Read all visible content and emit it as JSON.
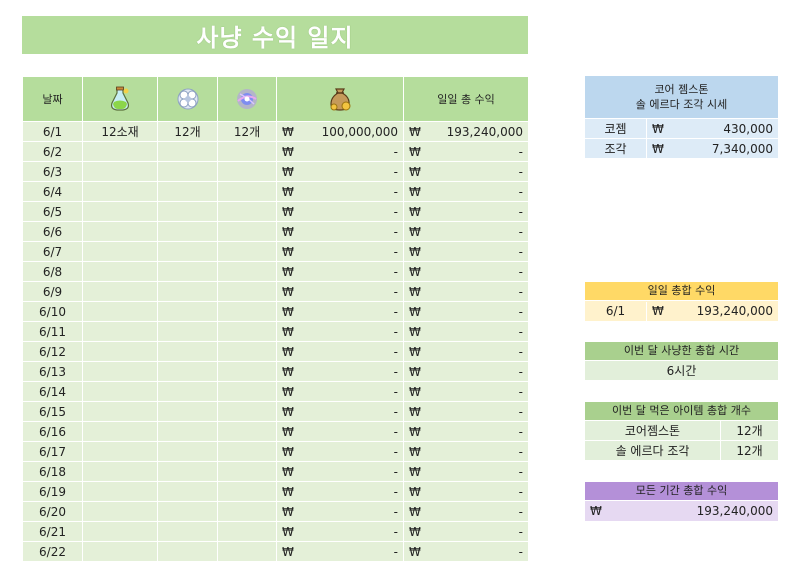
{
  "title": "사냥 수익 일지",
  "table": {
    "headers": {
      "date": "날짜",
      "total": "일일 총 수익"
    },
    "header_icons": [
      "potion-icon",
      "core-gemstone-icon",
      "sol-erda-fragment-icon",
      "meso-bag-icon"
    ],
    "currency": "₩",
    "rows": [
      {
        "date": "6/1",
        "col1": "12소재",
        "col2": "12개",
        "col3": "12개",
        "meso": "100,000,000",
        "total": "193,240,000"
      },
      {
        "date": "6/2",
        "col1": "",
        "col2": "",
        "col3": "",
        "meso": "-",
        "total": "-"
      },
      {
        "date": "6/3",
        "col1": "",
        "col2": "",
        "col3": "",
        "meso": "-",
        "total": "-"
      },
      {
        "date": "6/4",
        "col1": "",
        "col2": "",
        "col3": "",
        "meso": "-",
        "total": "-"
      },
      {
        "date": "6/5",
        "col1": "",
        "col2": "",
        "col3": "",
        "meso": "-",
        "total": "-"
      },
      {
        "date": "6/6",
        "col1": "",
        "col2": "",
        "col3": "",
        "meso": "-",
        "total": "-"
      },
      {
        "date": "6/7",
        "col1": "",
        "col2": "",
        "col3": "",
        "meso": "-",
        "total": "-"
      },
      {
        "date": "6/8",
        "col1": "",
        "col2": "",
        "col3": "",
        "meso": "-",
        "total": "-"
      },
      {
        "date": "6/9",
        "col1": "",
        "col2": "",
        "col3": "",
        "meso": "-",
        "total": "-"
      },
      {
        "date": "6/10",
        "col1": "",
        "col2": "",
        "col3": "",
        "meso": "-",
        "total": "-"
      },
      {
        "date": "6/11",
        "col1": "",
        "col2": "",
        "col3": "",
        "meso": "-",
        "total": "-"
      },
      {
        "date": "6/12",
        "col1": "",
        "col2": "",
        "col3": "",
        "meso": "-",
        "total": "-"
      },
      {
        "date": "6/13",
        "col1": "",
        "col2": "",
        "col3": "",
        "meso": "-",
        "total": "-"
      },
      {
        "date": "6/14",
        "col1": "",
        "col2": "",
        "col3": "",
        "meso": "-",
        "total": "-"
      },
      {
        "date": "6/15",
        "col1": "",
        "col2": "",
        "col3": "",
        "meso": "-",
        "total": "-"
      },
      {
        "date": "6/16",
        "col1": "",
        "col2": "",
        "col3": "",
        "meso": "-",
        "total": "-"
      },
      {
        "date": "6/17",
        "col1": "",
        "col2": "",
        "col3": "",
        "meso": "-",
        "total": "-"
      },
      {
        "date": "6/18",
        "col1": "",
        "col2": "",
        "col3": "",
        "meso": "-",
        "total": "-"
      },
      {
        "date": "6/19",
        "col1": "",
        "col2": "",
        "col3": "",
        "meso": "-",
        "total": "-"
      },
      {
        "date": "6/20",
        "col1": "",
        "col2": "",
        "col3": "",
        "meso": "-",
        "total": "-"
      },
      {
        "date": "6/21",
        "col1": "",
        "col2": "",
        "col3": "",
        "meso": "-",
        "total": "-"
      },
      {
        "date": "6/22",
        "col1": "",
        "col2": "",
        "col3": "",
        "meso": "-",
        "total": "-"
      }
    ]
  },
  "price_panel": {
    "title_line1": "코어 젬스톤",
    "title_line2": "솔 에르다 조각 시세",
    "rows": [
      {
        "label": "코젬",
        "currency": "₩",
        "value": "430,000"
      },
      {
        "label": "조각",
        "currency": "₩",
        "value": "7,340,000"
      }
    ]
  },
  "daily_total_panel": {
    "title": "일일 총합 수익",
    "date": "6/1",
    "currency": "₩",
    "value": "193,240,000"
  },
  "hunting_time_panel": {
    "title": "이번 달 사냥한 총합 시간",
    "value": "6시간"
  },
  "items_panel": {
    "title": "이번 달 먹은 아이템 총합 개수",
    "rows": [
      {
        "label": "코어젬스톤",
        "value": "12개"
      },
      {
        "label": "솔 에르다 조각",
        "value": "12개"
      }
    ]
  },
  "all_time_panel": {
    "title": "모든 기간 총합 수익",
    "currency": "₩",
    "value": "193,240,000"
  },
  "colors": {
    "green_header": "#b5dd9c",
    "green_cell": "#e4f0d8",
    "blue_header": "#bcd7ee",
    "blue_cell": "#ddebf7",
    "yellow_header": "#ffd966",
    "yellow_cell": "#fff2cc",
    "green_panel_header": "#a9d08e",
    "purple_header": "#b490d8",
    "purple_cell": "#e6d9f2"
  }
}
